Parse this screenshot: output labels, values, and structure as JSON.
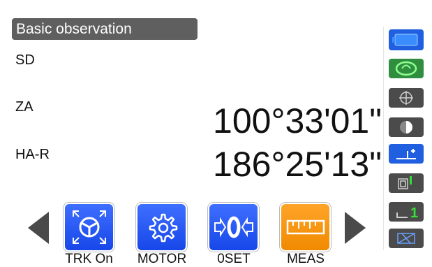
{
  "screen": {
    "title": "Basic observation",
    "observations": [
      {
        "label": "SD",
        "value": ""
      },
      {
        "label": "ZA",
        "value": "100°33'01\""
      },
      {
        "label": "HA-R",
        "value": "186°25'13\""
      }
    ]
  },
  "softkeys": [
    {
      "label": "TRK On",
      "icon": "target-tracking-icon",
      "color": "#2f5bff"
    },
    {
      "label": "MOTOR",
      "icon": "gear-icon",
      "color": "#2f5bff"
    },
    {
      "label": "0SET",
      "icon": "zero-set-icon",
      "color": "#2f5bff"
    },
    {
      "label": "MEAS",
      "icon": "ruler-icon",
      "color": "#f7931e"
    }
  ],
  "side_icons": [
    {
      "name": "battery-icon"
    },
    {
      "name": "laser-icon"
    },
    {
      "name": "prism-target-icon"
    },
    {
      "name": "half-circle-icon"
    },
    {
      "name": "instrument-height-icon"
    },
    {
      "name": "memory-card-icon"
    },
    {
      "name": "face-one-icon",
      "text": "1"
    },
    {
      "name": "compensator-icon"
    }
  ],
  "colors": {
    "accent_blue": "#1f5fe0",
    "accent_orange": "#f7931e",
    "title_bar": "#5f5f5f"
  }
}
